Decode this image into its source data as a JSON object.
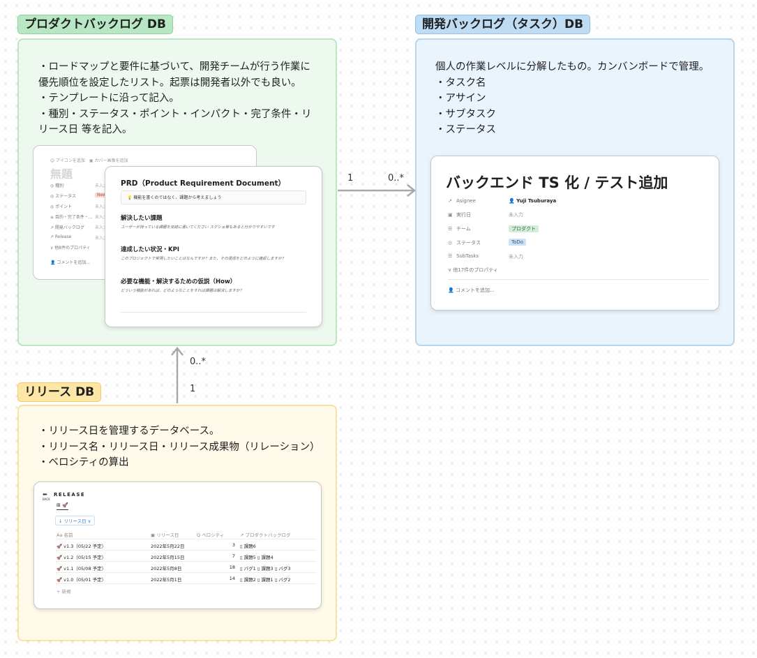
{
  "product_backlog": {
    "tag": "プロダクトバックログ DB",
    "lines": [
      "・ロードマップと要件に基づいて、開発チームが行う作業に",
      "優先順位を設定したリスト。起票は開発者以外でも良い。",
      "・テンプレートに沿って記入。",
      "・種別・ステータス・ポイント・インパクト・完了条件・リ",
      "リース日 等を記入。"
    ],
    "notion_page": {
      "top": "☺ アイコンを追加　▣ カバー画像を追加",
      "title": "無題",
      "props": [
        {
          "label": "◎ 種別",
          "value": "未入力"
        },
        {
          "label": "◎ ステータス",
          "value": "New"
        },
        {
          "label": "◎ ポイント",
          "value": "未入力"
        },
        {
          "label": "≡ 目的・完了条件・...",
          "value": "未入力"
        },
        {
          "label": "↗ 開発バックログ",
          "value": "未入力"
        },
        {
          "label": "↗ Release",
          "value": "未入力"
        },
        {
          "label": "∨ 他8件のプロパティ",
          "value": ""
        }
      ],
      "comment": "コメントを追加..."
    },
    "prd": {
      "title": "PRD（Product Requirement Document）",
      "callout": "💡 機能を書くのではなく、課題から考えましょう",
      "sections": [
        {
          "heading": "解決したい課題",
          "sub": "ユーザーが持っている課題を完結に書いてください スクショ等もあると分かりやすいです"
        },
        {
          "heading": "達成したい状況・KPI",
          "sub": "このプロジェクトで実現したいことはなんですか？また、その達成をどのように確認しますか？"
        },
        {
          "heading": "必要な機能・解決するための仮説（How）",
          "sub": "どういう機能があれば、どのようなことをすれば課題は解決しますか？"
        }
      ]
    }
  },
  "dev_backlog": {
    "tag": "開発バックログ（タスク）DB",
    "lines": [
      "個人の作業レベルに分解したもの。カンバンボードで管理。",
      "・タスク名",
      "・アサイン",
      "・サブタスク",
      "・ステータス"
    ],
    "task": {
      "title": "バックエンド TS 化 / テスト追加",
      "props": [
        {
          "icon": "↗",
          "label": "Asignee",
          "value": "Yuji Tsuburaya"
        },
        {
          "icon": "▣",
          "label": "実行日",
          "value": "未入力"
        },
        {
          "icon": "☰",
          "label": "チーム",
          "value": "プロダクト"
        },
        {
          "icon": "◎",
          "label": "ステータス",
          "value": "ToDo"
        },
        {
          "icon": "☰",
          "label": "SubTasks",
          "value": "未入力"
        }
      ],
      "more": "∨ 他17件のプロパティ",
      "comment": "コメントを追加..."
    }
  },
  "release": {
    "tag": "リリース DB",
    "lines": [
      "・リリース日を管理するデータベース。",
      "・リリース名・リリース日・リリース成果物（リレーション）",
      "・ベロシティの算出"
    ],
    "table": {
      "title": "RELEASE",
      "back_label": "BACK",
      "view": "⊞ 🚀",
      "filter": "↓ リリース日 ∨",
      "columns": [
        "Aa 名前",
        "▣ リリース日",
        "Q ベロシティ",
        "↗ プロダクトバックログ"
      ],
      "rows": [
        {
          "name": "🚀 v1.3（05/22 予定）",
          "date": "2022年5月22日",
          "velocity": "3",
          "items": "▯ 課題6"
        },
        {
          "name": "🚀 v1.2（05/15 予定）",
          "date": "2022年5月15日",
          "velocity": "7",
          "items": "▯ 課題5  ▯ 課題4"
        },
        {
          "name": "🚀 v1.1（05/08 予定）",
          "date": "2022年5月8日",
          "velocity": "18",
          "items": "▯ バグ1  ▯ 課題3  ▯ バグ3"
        },
        {
          "name": "🚀 v1.0（05/01 予定）",
          "date": "2022年5月1日",
          "velocity": "14",
          "items": "▯ 課題2  ▯ 課題1  ▯ バグ2"
        }
      ],
      "new": "+ 新規"
    }
  },
  "relations": {
    "product_to_dev": {
      "from": "1",
      "to": "0..*"
    },
    "release_to_product": {
      "to": "0..*",
      "from": "1"
    }
  }
}
